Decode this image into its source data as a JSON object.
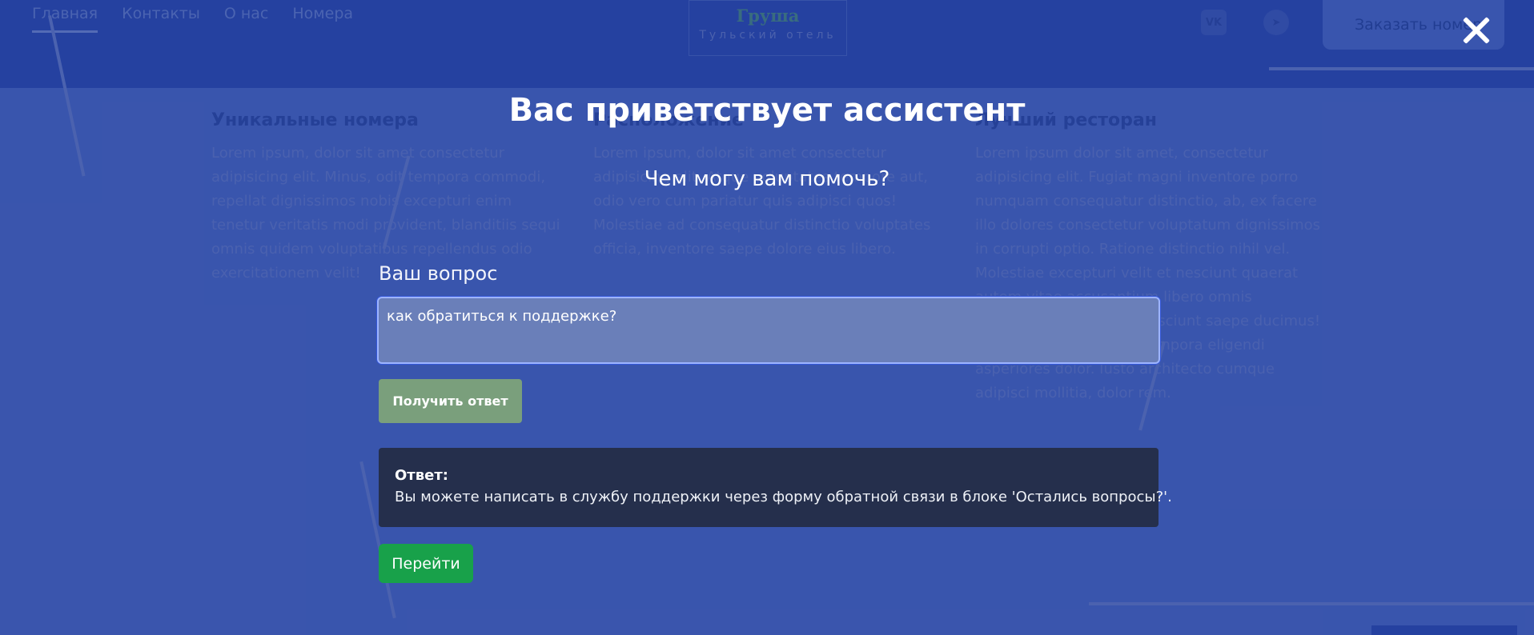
{
  "colors": {
    "page_background": "#4f6fd0",
    "header_background": "#2a4bb8",
    "overlay": "rgba(32,54,130,0.45)",
    "question_input_bg": "#6a7fb9",
    "get_answer_button": "#7a9f7c",
    "answer_box": "#252f4c",
    "go_button": "#18a14a",
    "text": "#ffffff"
  },
  "background": {
    "nav": [
      {
        "label": "Главная",
        "active": true
      },
      {
        "label": "Контакты",
        "active": false
      },
      {
        "label": "О нас",
        "active": false
      },
      {
        "label": "Номера",
        "active": false
      }
    ],
    "logo": {
      "title": "Груша",
      "subtitle": "Тульский отель"
    },
    "social": [
      {
        "icon": "vk-icon",
        "label": "VK"
      },
      {
        "icon": "telegram-icon",
        "label": "➤"
      }
    ],
    "order_button": "Заказать номер",
    "columns": [
      {
        "title": "Уникальные номера",
        "text": "Lorem ipsum, dolor sit amet consectetur adipisicing elit. Minus, odit tempora commodi, repellat dignissimos nobis excepturi enim tenetur veritatis modi provident, blanditiis sequi omnis quidem voluptatibus repellendus odio exercitationem velit!"
      },
      {
        "title": "Расположение",
        "text": "Lorem ipsum, dolor sit amet consectetur adipisicing elit. Atque voluptates tempore aut, odio vero cum pariatur quis adipisci quos! Molestiae ad consequatur distinctio voluptates officia, inventore saepe dolore eius libero."
      },
      {
        "title": "Лучший ресторан",
        "text": "Lorem ipsum dolor sit amet, consectetur adipisicing elit. Fugiat magni inventore porro numquam consequatur distinctio, ab, ex facere illo dolores consectetur voluptatum dignissimos in corrupti optio. Ratione distinctio nihil vel. Molestiae excepturi velit et nesciunt quaerat autem vitae accusantium libero omnis voluptatum. Excepturi nesciunt saepe ducimus! Eveniet provident quis tempora eligendi asperiores dolor. Iusto architecto cumque adipisci mollitia, dolor rem."
      }
    ]
  },
  "modal": {
    "close_icon": "close-icon",
    "title": "Вас приветствует ассистент",
    "subtitle": "Чем могу вам помочь?",
    "question_label": "Ваш вопрос",
    "question_value": "как обратиться к поддержке?",
    "get_answer_button": "Получить ответ",
    "answer_label": "Ответ:",
    "answer_text": "Вы можете написать в службу поддержки через форму обратной связи в блоке 'Остались вопросы?'.",
    "go_button": "Перейти"
  }
}
